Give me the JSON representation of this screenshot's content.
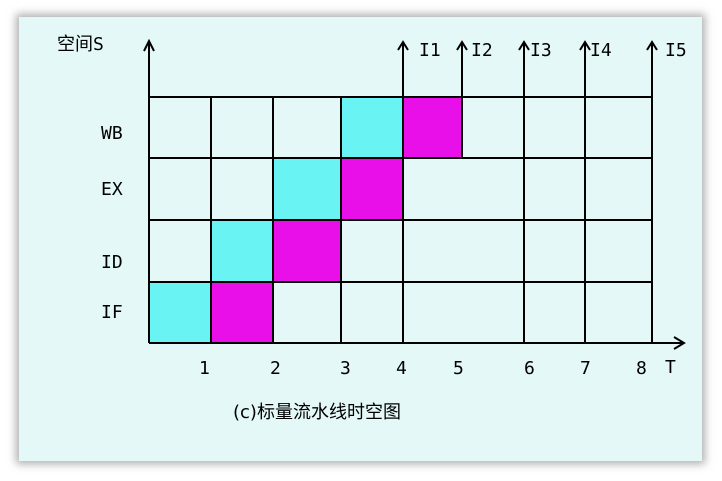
{
  "axis_labels": {
    "y": "空间S",
    "x": "T"
  },
  "stage_labels": [
    "WB",
    "EX",
    "ID",
    "IF"
  ],
  "time_labels": [
    "1",
    "2",
    "3",
    "4",
    "5",
    "6",
    "7",
    "8"
  ],
  "instruction_labels": [
    "I1",
    "I2",
    "I3",
    "I4",
    "I5"
  ],
  "caption": "(c)标量流水线时空图",
  "colors": {
    "cyan": "#6af3f3",
    "magenta": "#e80fe8",
    "background": "#e3f8f7",
    "line": "#000000"
  },
  "occupied_cells": [
    {
      "stage": "IF",
      "slot": 1,
      "color": "cyan"
    },
    {
      "stage": "IF",
      "slot": 2,
      "color": "magenta"
    },
    {
      "stage": "ID",
      "slot": 2,
      "color": "cyan"
    },
    {
      "stage": "ID",
      "slot": 3,
      "color": "magenta"
    },
    {
      "stage": "EX",
      "slot": 3,
      "color": "cyan"
    },
    {
      "stage": "EX",
      "slot": 4,
      "color": "magenta"
    },
    {
      "stage": "WB",
      "slot": 4,
      "color": "cyan"
    },
    {
      "stage": "WB",
      "slot": 5,
      "color": "magenta"
    }
  ]
}
